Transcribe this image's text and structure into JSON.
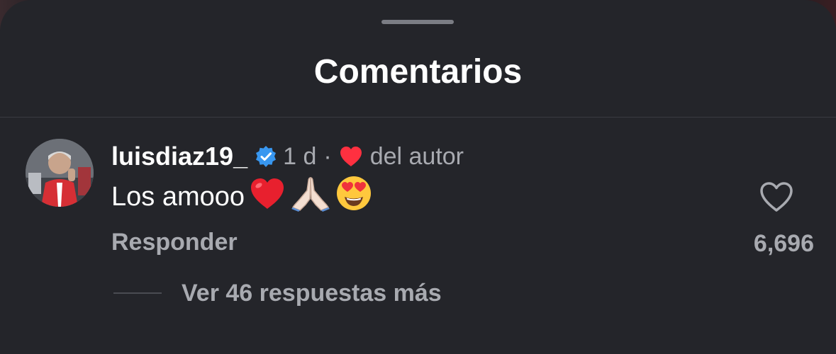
{
  "sheet": {
    "title": "Comentarios"
  },
  "comment": {
    "username": "luisdiaz19_",
    "verified_icon": "verified-badge-icon",
    "time": "1 d",
    "separator": "·",
    "author_like_icon": "red-heart-icon",
    "author_like_label": "del autor",
    "text": "Los amooo",
    "emojis": [
      "red-heart-emoji",
      "folded-hands-emoji",
      "heart-eyes-emoji"
    ],
    "reply_label": "Responder",
    "like_icon": "heart-outline-icon",
    "like_count": "6,696",
    "view_replies_label": "Ver 46 respuestas más"
  },
  "colors": {
    "sheet_background": "#24252a",
    "primary_text": "#ffffff",
    "secondary_text": "#a8aab0",
    "verified_blue": "#3897f0",
    "heart_red": "#ff3040"
  }
}
